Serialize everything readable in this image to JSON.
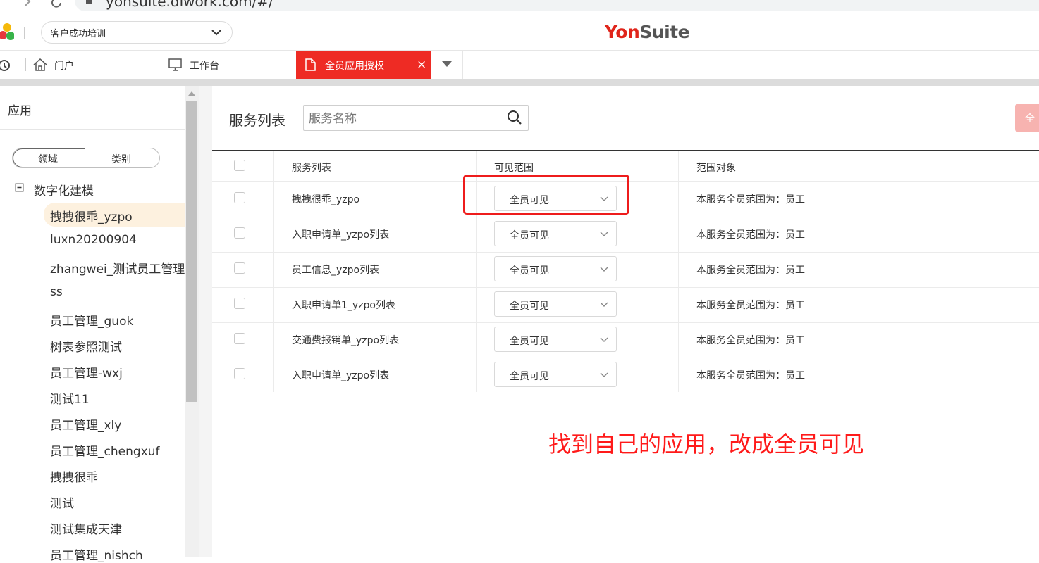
{
  "browser": {
    "url": "yonsuite.diwork.com/#/"
  },
  "header": {
    "tenant_label": "客户成功培训",
    "brand": {
      "yon": "Yon",
      "suite": "Suite",
      "yon_color": "#e0251b",
      "suite_color": "#555555"
    }
  },
  "tabs": {
    "portal": "门户",
    "workbench": "工作台",
    "active": "全员应用授权",
    "close": "×"
  },
  "sidebar": {
    "title": "应用",
    "toggle": {
      "domain": "领域",
      "category": "类别"
    },
    "tree_root": "数字化建模",
    "items": [
      "拽拽很乖_yzpo",
      "luxn20200904",
      "zhangwei_测试员工管理",
      "ss",
      "员工管理_guok",
      "树表参照测试",
      "员工管理-wxj",
      "测试11",
      "员工管理_xly",
      "员工管理_chengxuf",
      "拽拽很乖",
      "测试",
      "测试集成天津",
      "员工管理_nishch"
    ],
    "selected_index": 0
  },
  "main": {
    "title": "服务列表",
    "search_placeholder": "服务名称",
    "top_right_button": "全",
    "columns": {
      "service": "服务列表",
      "visibility": "可见范围",
      "scope": "范围对象"
    },
    "rows": [
      {
        "service": "拽拽很乖_yzpo",
        "visibility": "全员可见",
        "scope": "本服务全员范围为：员工"
      },
      {
        "service": "入职申请单_yzpo列表",
        "visibility": "全员可见",
        "scope": "本服务全员范围为：员工"
      },
      {
        "service": "员工信息_yzpo列表",
        "visibility": "全员可见",
        "scope": "本服务全员范围为：员工"
      },
      {
        "service": "入职申请单1_yzpo列表",
        "visibility": "全员可见",
        "scope": "本服务全员范围为：员工"
      },
      {
        "service": "交通费报销单_yzpo列表",
        "visibility": "全员可见",
        "scope": "本服务全员范围为：员工"
      },
      {
        "service": "入职申请单_yzpo列表",
        "visibility": "全员可见",
        "scope": "本服务全员范围为：员工"
      }
    ]
  },
  "annotation": {
    "text": "找到自己的应用，改成全员可见",
    "color": "#ff1a1a"
  },
  "colors": {
    "active_tab": "#ee2b24",
    "selected_item_bg": "#fdf1df"
  }
}
